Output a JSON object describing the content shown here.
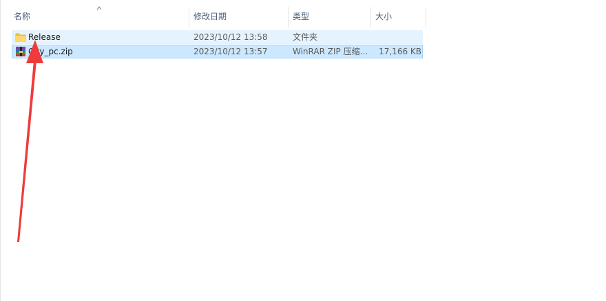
{
  "columns": {
    "name": "名称",
    "modified": "修改日期",
    "type": "类型",
    "size": "大小"
  },
  "sort": {
    "column": "name",
    "direction": "ascending",
    "icon": "chevron-up-icon"
  },
  "files": [
    {
      "name": "Release",
      "modified": "2023/10/12 13:58",
      "type": "文件夹",
      "size": "",
      "icon": "folder-icon",
      "state": "hover"
    },
    {
      "name": "City_pc.zip",
      "modified": "2023/10/12 13:57",
      "type": "WinRAR ZIP 压缩...",
      "size": "17,166 KB",
      "icon": "winrar-archive-icon",
      "state": "selected"
    }
  ],
  "colors": {
    "hover_bg": "#e5f3ff",
    "selected_bg": "#cce8ff",
    "selected_border": "#99d1ff",
    "header_text": "#4c607a",
    "annotation_arrow": "#ef3b3b"
  }
}
